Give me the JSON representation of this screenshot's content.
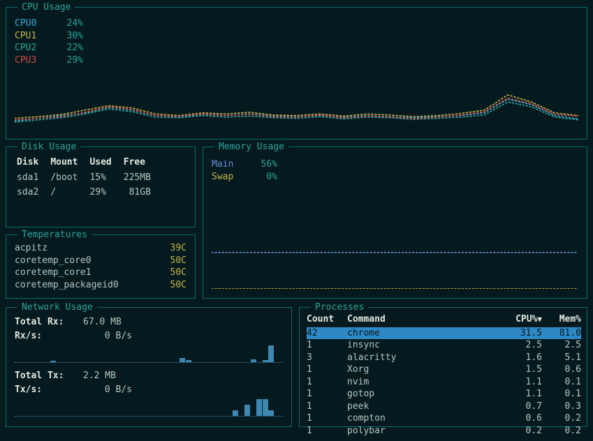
{
  "panels": {
    "cpu": "CPU Usage",
    "disk": "Disk Usage",
    "temps": "Temperatures",
    "mem": "Memory Usage",
    "net": "Network Usage",
    "procs": "Processes"
  },
  "cpu": {
    "cores": [
      {
        "label": "CPU0",
        "pct": "24%"
      },
      {
        "label": "CPU1",
        "pct": "30%"
      },
      {
        "label": "CPU2",
        "pct": "22%"
      },
      {
        "label": "CPU3",
        "pct": "29%"
      }
    ]
  },
  "disk": {
    "headers": {
      "disk": "Disk",
      "mount": "Mount",
      "used": "Used",
      "free": "Free"
    },
    "rows": [
      {
        "disk": "sda1",
        "mount": "/boot",
        "used": "15%",
        "free": "225MB"
      },
      {
        "disk": "sda2",
        "mount": "/",
        "used": "29%",
        "free": "81GB"
      }
    ]
  },
  "temps": {
    "rows": [
      {
        "label": "acpitz",
        "val": "39C"
      },
      {
        "label": "coretemp_core0",
        "val": "50C"
      },
      {
        "label": "coretemp_core1",
        "val": "50C"
      },
      {
        "label": "coretemp_packageid0",
        "val": "50C"
      }
    ]
  },
  "mem": {
    "main_label": "Main",
    "main_pct": "56%",
    "swap_label": "Swap",
    "swap_pct": "0%"
  },
  "net": {
    "rx_total_label": "Total Rx:",
    "rx_total": "67.0 MB",
    "rx_rate_label": "Rx/s:",
    "rx_rate": "0  B/s",
    "tx_total_label": "Total Tx:",
    "tx_total": "2.2 MB",
    "tx_rate_label": "Tx/s:",
    "tx_rate": "0  B/s"
  },
  "procs": {
    "headers": {
      "count": "Count",
      "command": "Command",
      "cpu": "CPU%",
      "mem": "Mem%",
      "sort_indicator": "▼"
    },
    "rows": [
      {
        "count": "42",
        "command": "chrome",
        "cpu": "31.5",
        "mem": "81.0",
        "selected": true
      },
      {
        "count": "1",
        "command": "insync",
        "cpu": "2.5",
        "mem": "2.5"
      },
      {
        "count": "3",
        "command": "alacritty",
        "cpu": "1.6",
        "mem": "5.1"
      },
      {
        "count": "1",
        "command": "Xorg",
        "cpu": "1.5",
        "mem": "0.6"
      },
      {
        "count": "1",
        "command": "nvim",
        "cpu": "1.1",
        "mem": "0.1"
      },
      {
        "count": "1",
        "command": "gotop",
        "cpu": "1.1",
        "mem": "0.1"
      },
      {
        "count": "1",
        "command": "peek",
        "cpu": "0.7",
        "mem": "0.3"
      },
      {
        "count": "1",
        "command": "compton",
        "cpu": "0.6",
        "mem": "0.2"
      },
      {
        "count": "1",
        "command": "polybar",
        "cpu": "0.2",
        "mem": "0.2"
      }
    ]
  },
  "chart_data": [
    {
      "type": "line",
      "title": "CPU Usage",
      "ylabel": "%",
      "ylim": [
        0,
        100
      ],
      "series": [
        {
          "name": "CPU0",
          "color": "#3da7d6",
          "values": [
            20,
            25,
            30,
            35,
            45,
            40,
            30,
            28,
            32,
            30,
            33,
            29,
            28,
            30,
            27,
            30,
            28,
            26,
            28,
            30,
            35,
            60,
            50,
            30,
            24
          ]
        },
        {
          "name": "CPU1",
          "color": "#c6b34a",
          "values": [
            25,
            28,
            32,
            40,
            48,
            44,
            33,
            30,
            35,
            33,
            36,
            31,
            30,
            33,
            29,
            33,
            31,
            28,
            30,
            34,
            40,
            68,
            55,
            35,
            30
          ]
        },
        {
          "name": "CPU2",
          "color": "#2ea39a",
          "values": [
            18,
            22,
            26,
            33,
            42,
            37,
            27,
            26,
            30,
            27,
            29,
            26,
            25,
            28,
            24,
            27,
            26,
            23,
            25,
            27,
            31,
            55,
            46,
            27,
            22
          ]
        },
        {
          "name": "CPU3",
          "color": "#cf4a4a",
          "values": [
            22,
            25,
            28,
            36,
            46,
            41,
            30,
            29,
            33,
            30,
            32,
            28,
            27,
            31,
            26,
            29,
            28,
            24,
            27,
            31,
            37,
            62,
            52,
            32,
            29
          ]
        }
      ]
    },
    {
      "type": "line",
      "title": "Memory Usage",
      "ylabel": "%",
      "ylim": [
        0,
        100
      ],
      "series": [
        {
          "name": "Main",
          "color": "#6b8fe0",
          "values": [
            56,
            56,
            56,
            56,
            56,
            56,
            56,
            56,
            56,
            56,
            56,
            56,
            56,
            56,
            56,
            56,
            56,
            56,
            56,
            56
          ]
        },
        {
          "name": "Swap",
          "color": "#c6b34a",
          "values": [
            0,
            0,
            0,
            0,
            0,
            0,
            0,
            0,
            0,
            0,
            0,
            0,
            0,
            0,
            0,
            0,
            0,
            0,
            0,
            0
          ]
        }
      ]
    },
    {
      "type": "bar",
      "title": "Network Rx/s",
      "ylabel": "B/s",
      "values": [
        0,
        0,
        0,
        0,
        0,
        0,
        2,
        0,
        0,
        0,
        0,
        0,
        0,
        0,
        0,
        0,
        0,
        0,
        0,
        0,
        0,
        0,
        0,
        0,
        0,
        0,
        0,
        0,
        6,
        3,
        0,
        0,
        0,
        0,
        0,
        0,
        0,
        0,
        0,
        0,
        4,
        0,
        3,
        22,
        0
      ]
    },
    {
      "type": "bar",
      "title": "Network Tx/s",
      "ylabel": "B/s",
      "values": [
        0,
        0,
        0,
        0,
        0,
        0,
        0,
        0,
        0,
        0,
        0,
        0,
        0,
        0,
        0,
        0,
        0,
        0,
        0,
        0,
        0,
        0,
        0,
        0,
        0,
        0,
        0,
        0,
        0,
        0,
        0,
        0,
        0,
        0,
        0,
        0,
        0,
        4,
        0,
        8,
        0,
        12,
        12,
        4,
        0
      ]
    }
  ]
}
